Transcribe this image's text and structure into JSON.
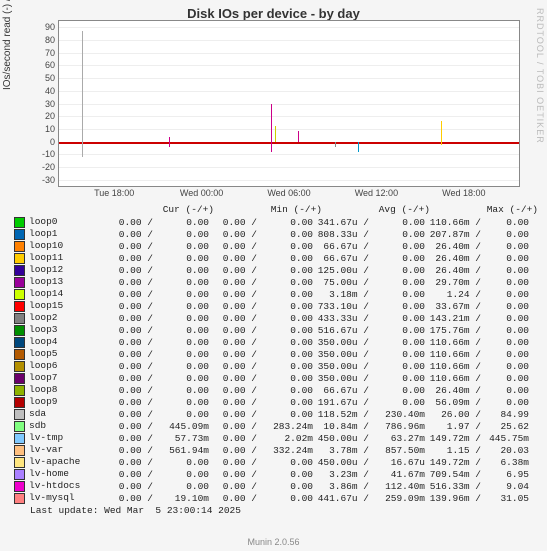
{
  "title": "Disk IOs per device - by day",
  "ylabel": "IOs/second read (-) / write (+)",
  "rlabel": "RRDTOOL / TOBI OETIKER",
  "footer": "Munin 2.0.56",
  "last_update": "Last update: Wed Mar  5 23:00:14 2025",
  "chart_data": {
    "type": "line",
    "yticks": [
      -30,
      -20,
      -10,
      0,
      10,
      20,
      30,
      40,
      50,
      60,
      70,
      80,
      90
    ],
    "ylim": [
      -35,
      95
    ],
    "xlabels": [
      "Tue 18:00",
      "Wed 00:00",
      "Wed 06:00",
      "Wed 12:00",
      "Wed 18:00"
    ],
    "xpos": [
      12,
      31,
      50,
      69,
      88
    ],
    "spikes": [
      {
        "x": 5,
        "h": 87,
        "c": "#aaa"
      },
      {
        "x": 5,
        "h": -12,
        "c": "#aaa"
      },
      {
        "x": 24,
        "h": 4,
        "c": "#c08"
      },
      {
        "x": 24,
        "h": -4,
        "c": "#c08"
      },
      {
        "x": 46,
        "h": 30,
        "c": "#c08"
      },
      {
        "x": 46,
        "h": -8,
        "c": "#c08"
      },
      {
        "x": 47,
        "h": 12,
        "c": "#cc0"
      },
      {
        "x": 52,
        "h": 8,
        "c": "#c08"
      },
      {
        "x": 60,
        "h": -4,
        "c": "#888"
      },
      {
        "x": 65,
        "h": -8,
        "c": "#09c"
      },
      {
        "x": 83,
        "h": 16,
        "c": "#fc0"
      },
      {
        "x": 83,
        "h": -3,
        "c": "#fc0"
      }
    ]
  },
  "legend": {
    "header_cols": [
      "Cur (-/+)",
      "Min (-/+)",
      "Avg (-/+)",
      "Max (-/+)"
    ],
    "rows": [
      {
        "c": "#00cc00",
        "n": "loop0",
        "cur": [
          "0.00",
          "0.00"
        ],
        "min": [
          "0.00",
          "0.00"
        ],
        "avg": [
          "341.67u",
          "0.00"
        ],
        "max": [
          "110.66m",
          "0.00"
        ]
      },
      {
        "c": "#0066b3",
        "n": "loop1",
        "cur": [
          "0.00",
          "0.00"
        ],
        "min": [
          "0.00",
          "0.00"
        ],
        "avg": [
          "808.33u",
          "0.00"
        ],
        "max": [
          "207.87m",
          "0.00"
        ]
      },
      {
        "c": "#ff8000",
        "n": "loop10",
        "cur": [
          "0.00",
          "0.00"
        ],
        "min": [
          "0.00",
          "0.00"
        ],
        "avg": [
          "66.67u",
          "0.00"
        ],
        "max": [
          "26.40m",
          "0.00"
        ]
      },
      {
        "c": "#ffcc00",
        "n": "loop11",
        "cur": [
          "0.00",
          "0.00"
        ],
        "min": [
          "0.00",
          "0.00"
        ],
        "avg": [
          "66.67u",
          "0.00"
        ],
        "max": [
          "26.40m",
          "0.00"
        ]
      },
      {
        "c": "#330099",
        "n": "loop12",
        "cur": [
          "0.00",
          "0.00"
        ],
        "min": [
          "0.00",
          "0.00"
        ],
        "avg": [
          "125.00u",
          "0.00"
        ],
        "max": [
          "26.40m",
          "0.00"
        ]
      },
      {
        "c": "#990099",
        "n": "loop13",
        "cur": [
          "0.00",
          "0.00"
        ],
        "min": [
          "0.00",
          "0.00"
        ],
        "avg": [
          "75.00u",
          "0.00"
        ],
        "max": [
          "29.70m",
          "0.00"
        ]
      },
      {
        "c": "#ccff00",
        "n": "loop14",
        "cur": [
          "0.00",
          "0.00"
        ],
        "min": [
          "0.00",
          "0.00"
        ],
        "avg": [
          "3.18m",
          "0.00"
        ],
        "max": [
          "1.24",
          "0.00"
        ]
      },
      {
        "c": "#ff0000",
        "n": "loop15",
        "cur": [
          "0.00",
          "0.00"
        ],
        "min": [
          "0.00",
          "0.00"
        ],
        "avg": [
          "733.10u",
          "0.00"
        ],
        "max": [
          "33.67m",
          "0.00"
        ]
      },
      {
        "c": "#808080",
        "n": "loop2",
        "cur": [
          "0.00",
          "0.00"
        ],
        "min": [
          "0.00",
          "0.00"
        ],
        "avg": [
          "433.33u",
          "0.00"
        ],
        "max": [
          "143.21m",
          "0.00"
        ]
      },
      {
        "c": "#008f00",
        "n": "loop3",
        "cur": [
          "0.00",
          "0.00"
        ],
        "min": [
          "0.00",
          "0.00"
        ],
        "avg": [
          "516.67u",
          "0.00"
        ],
        "max": [
          "175.76m",
          "0.00"
        ]
      },
      {
        "c": "#00487d",
        "n": "loop4",
        "cur": [
          "0.00",
          "0.00"
        ],
        "min": [
          "0.00",
          "0.00"
        ],
        "avg": [
          "350.00u",
          "0.00"
        ],
        "max": [
          "110.66m",
          "0.00"
        ]
      },
      {
        "c": "#b35a00",
        "n": "loop5",
        "cur": [
          "0.00",
          "0.00"
        ],
        "min": [
          "0.00",
          "0.00"
        ],
        "avg": [
          "350.00u",
          "0.00"
        ],
        "max": [
          "110.66m",
          "0.00"
        ]
      },
      {
        "c": "#b38f00",
        "n": "loop6",
        "cur": [
          "0.00",
          "0.00"
        ],
        "min": [
          "0.00",
          "0.00"
        ],
        "avg": [
          "350.00u",
          "0.00"
        ],
        "max": [
          "110.66m",
          "0.00"
        ]
      },
      {
        "c": "#6b006b",
        "n": "loop7",
        "cur": [
          "0.00",
          "0.00"
        ],
        "min": [
          "0.00",
          "0.00"
        ],
        "avg": [
          "350.00u",
          "0.00"
        ],
        "max": [
          "110.66m",
          "0.00"
        ]
      },
      {
        "c": "#8fb300",
        "n": "loop8",
        "cur": [
          "0.00",
          "0.00"
        ],
        "min": [
          "0.00",
          "0.00"
        ],
        "avg": [
          "66.67u",
          "0.00"
        ],
        "max": [
          "26.40m",
          "0.00"
        ]
      },
      {
        "c": "#b30000",
        "n": "loop9",
        "cur": [
          "0.00",
          "0.00"
        ],
        "min": [
          "0.00",
          "0.00"
        ],
        "avg": [
          "191.67u",
          "0.00"
        ],
        "max": [
          "56.09m",
          "0.00"
        ]
      },
      {
        "c": "#bebebe",
        "n": "sda",
        "cur": [
          "0.00",
          "0.00"
        ],
        "min": [
          "0.00",
          "0.00"
        ],
        "avg": [
          "118.52m",
          "230.40m"
        ],
        "max": [
          "26.00",
          "84.99"
        ]
      },
      {
        "c": "#80ff80",
        "n": "sdb",
        "cur": [
          "0.00",
          "445.09m"
        ],
        "min": [
          "0.00",
          "283.24m"
        ],
        "avg": [
          "10.84m",
          "786.96m"
        ],
        "max": [
          "1.97",
          "25.62"
        ]
      },
      {
        "c": "#80c9ff",
        "n": "lv-tmp",
        "cur": [
          "0.00",
          "57.73m"
        ],
        "min": [
          "0.00",
          "2.02m"
        ],
        "avg": [
          "450.00u",
          "63.27m"
        ],
        "max": [
          "149.72m",
          "445.75m"
        ]
      },
      {
        "c": "#ffc080",
        "n": "lv-var",
        "cur": [
          "0.00",
          "561.94m"
        ],
        "min": [
          "0.00",
          "332.24m"
        ],
        "avg": [
          "3.78m",
          "857.50m"
        ],
        "max": [
          "1.15",
          "20.03"
        ]
      },
      {
        "c": "#ffe680",
        "n": "lv-apache",
        "cur": [
          "0.00",
          "0.00"
        ],
        "min": [
          "0.00",
          "0.00"
        ],
        "avg": [
          "450.00u",
          "16.67u"
        ],
        "max": [
          "149.72m",
          "6.38m"
        ]
      },
      {
        "c": "#aa80ff",
        "n": "lv-home",
        "cur": [
          "0.00",
          "0.00"
        ],
        "min": [
          "0.00",
          "0.00"
        ],
        "avg": [
          "3.23m",
          "41.67m"
        ],
        "max": [
          "709.54m",
          "6.95"
        ]
      },
      {
        "c": "#ee00cc",
        "n": "lv-htdocs",
        "cur": [
          "0.00",
          "0.00"
        ],
        "min": [
          "0.00",
          "0.00"
        ],
        "avg": [
          "3.86m",
          "112.40m"
        ],
        "max": [
          "516.33m",
          "9.04"
        ]
      },
      {
        "c": "#ff8080",
        "n": "lv-mysql",
        "cur": [
          "0.00",
          "19.10m"
        ],
        "min": [
          "0.00",
          "0.00"
        ],
        "avg": [
          "441.67u",
          "259.09m"
        ],
        "max": [
          "139.96m",
          "31.05"
        ]
      }
    ]
  }
}
